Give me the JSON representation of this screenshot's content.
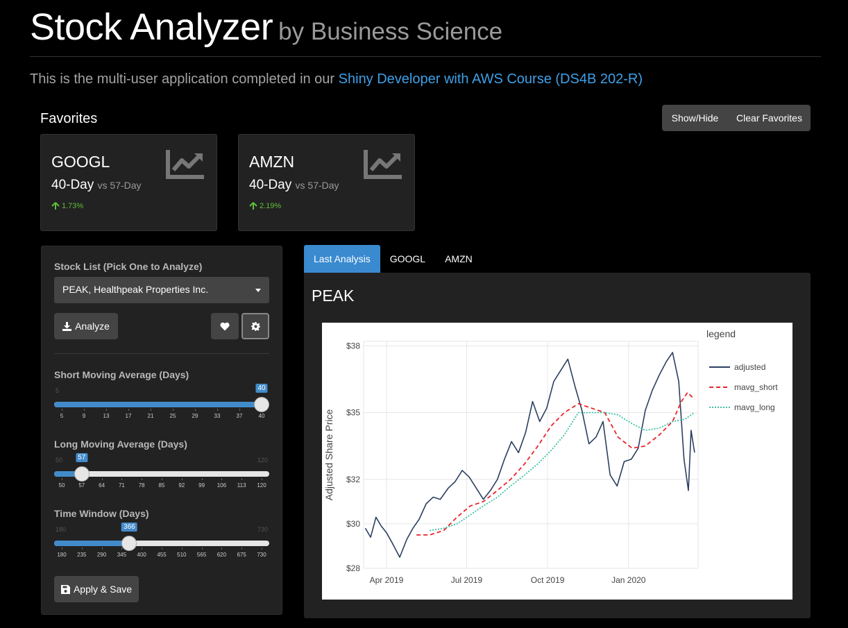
{
  "header": {
    "title": "Stock Analyzer",
    "subtitle": "by Business Science"
  },
  "intro": {
    "text": "This is the multi-user application completed in our ",
    "link": "Shiny Developer with AWS Course (DS4B 202-R)"
  },
  "favorites": {
    "title": "Favorites",
    "show_hide_label": "Show/Hide",
    "clear_label": "Clear Favorites",
    "cards": [
      {
        "symbol": "GOOGL",
        "period": "40-Day",
        "vs": "vs 57-Day",
        "change": "1.73%"
      },
      {
        "symbol": "AMZN",
        "period": "40-Day",
        "vs": "vs 57-Day",
        "change": "2.19%"
      }
    ]
  },
  "sidebar": {
    "stock_list_label": "Stock List (Pick One to Analyze)",
    "selected_stock": "PEAK, Healthpeak Properties Inc.",
    "analyze_label": "Analyze",
    "apply_label": "Apply & Save",
    "sliders": [
      {
        "label": "Short Moving Average (Days)",
        "min": 5,
        "max": 40,
        "value": 40,
        "min_label": "5",
        "max_label": "40",
        "ticks": [
          "5",
          "9",
          "13",
          "17",
          "21",
          "25",
          "29",
          "33",
          "37",
          "40"
        ]
      },
      {
        "label": "Long Moving Average (Days)",
        "min": 50,
        "max": 120,
        "value": 57,
        "min_label": "50",
        "max_label": "120",
        "ticks": [
          "50",
          "57",
          "64",
          "71",
          "78",
          "85",
          "92",
          "99",
          "106",
          "113",
          "120"
        ]
      },
      {
        "label": "Time Window (Days)",
        "min": 180,
        "max": 730,
        "value": 366,
        "min_label": "180",
        "max_label": "730",
        "ticks": [
          "180",
          "235",
          "290",
          "345",
          "400",
          "455",
          "510",
          "565",
          "620",
          "675",
          "730"
        ]
      }
    ]
  },
  "tabs": [
    {
      "label": "Last Analysis",
      "active": true
    },
    {
      "label": "GOOGL",
      "active": false
    },
    {
      "label": "AMZN",
      "active": false
    }
  ],
  "panel": {
    "title": "PEAK"
  },
  "colors": {
    "accent": "#428bca",
    "tab_active": "#3a8ad0",
    "positive": "#5fbf3b",
    "link": "#3fa0e8",
    "adjusted": "#2a3f5f",
    "mavg_short": "#e8252a",
    "mavg_long": "#3cc0a5"
  },
  "chart_data": {
    "type": "line",
    "ylabel": "Adjusted Share Price",
    "legend_title": "legend",
    "legend_position": "right",
    "grid": true,
    "ylim": [
      28,
      38.2
    ],
    "y_ticks": [
      28,
      30,
      32,
      35,
      38
    ],
    "y_tick_labels": [
      "$28",
      "$30",
      "$32",
      "$35",
      "$38"
    ],
    "x_range": [
      "2019-03-06",
      "2020-03-20"
    ],
    "x_ticks": [
      "2019-04-01",
      "2019-07-01",
      "2019-10-01",
      "2020-01-01"
    ],
    "x_tick_labels": [
      "Apr 2019",
      "Jul 2019",
      "Oct 2019",
      "Jan 2020"
    ],
    "series": [
      {
        "name": "adjusted",
        "style": "solid",
        "x": [
          "2019-03-08",
          "2019-03-14",
          "2019-03-20",
          "2019-03-26",
          "2019-04-01",
          "2019-04-08",
          "2019-04-16",
          "2019-04-24",
          "2019-05-01",
          "2019-05-08",
          "2019-05-16",
          "2019-05-24",
          "2019-06-01",
          "2019-06-10",
          "2019-06-18",
          "2019-06-26",
          "2019-07-04",
          "2019-07-12",
          "2019-07-20",
          "2019-07-28",
          "2019-08-05",
          "2019-08-13",
          "2019-08-21",
          "2019-08-29",
          "2019-09-06",
          "2019-09-14",
          "2019-09-22",
          "2019-09-30",
          "2019-10-08",
          "2019-10-16",
          "2019-10-24",
          "2019-11-01",
          "2019-11-09",
          "2019-11-17",
          "2019-11-25",
          "2019-12-03",
          "2019-12-11",
          "2019-12-19",
          "2019-12-27",
          "2020-01-04",
          "2020-01-12",
          "2020-01-20",
          "2020-01-28",
          "2020-02-05",
          "2020-02-13",
          "2020-02-20",
          "2020-02-27",
          "2020-03-04",
          "2020-03-09",
          "2020-03-12",
          "2020-03-16"
        ],
        "y": [
          29.8,
          29.4,
          30.3,
          29.9,
          29.6,
          29.1,
          28.5,
          29.3,
          29.8,
          30.2,
          30.9,
          31.2,
          31.1,
          31.6,
          31.9,
          32.4,
          32.1,
          31.6,
          31.1,
          31.5,
          32.0,
          32.9,
          33.7,
          33.2,
          34.1,
          35.5,
          34.6,
          35.2,
          36.4,
          36.9,
          37.4,
          36.2,
          35.1,
          33.6,
          33.9,
          34.6,
          32.2,
          31.7,
          32.8,
          32.9,
          33.4,
          35.1,
          36.0,
          36.7,
          37.3,
          37.7,
          36.4,
          32.9,
          31.5,
          34.2,
          33.2
        ]
      },
      {
        "name": "mavg_short",
        "style": "dashed",
        "x": [
          "2019-05-05",
          "2019-05-20",
          "2019-06-05",
          "2019-06-20",
          "2019-07-05",
          "2019-07-20",
          "2019-08-05",
          "2019-08-20",
          "2019-09-05",
          "2019-09-20",
          "2019-10-05",
          "2019-10-20",
          "2019-11-05",
          "2019-11-20",
          "2019-12-05",
          "2019-12-20",
          "2020-01-05",
          "2020-01-20",
          "2020-02-05",
          "2020-02-20",
          "2020-03-01",
          "2020-03-08",
          "2020-03-16"
        ],
        "y": [
          29.5,
          29.5,
          29.7,
          30.3,
          30.8,
          31.0,
          31.5,
          32.0,
          32.7,
          33.5,
          34.4,
          35.0,
          35.4,
          35.2,
          35.0,
          33.9,
          33.4,
          33.5,
          34.0,
          34.6,
          35.5,
          35.9,
          35.6
        ]
      },
      {
        "name": "mavg_long",
        "style": "dotted",
        "x": [
          "2019-05-20",
          "2019-06-05",
          "2019-06-20",
          "2019-07-05",
          "2019-07-20",
          "2019-08-05",
          "2019-08-20",
          "2019-09-05",
          "2019-09-20",
          "2019-10-05",
          "2019-10-20",
          "2019-11-05",
          "2019-11-20",
          "2019-12-05",
          "2019-12-20",
          "2020-01-05",
          "2020-01-20",
          "2020-02-05",
          "2020-02-20",
          "2020-03-05",
          "2020-03-16"
        ],
        "y": [
          29.7,
          29.8,
          30.0,
          30.4,
          30.8,
          31.2,
          31.7,
          32.2,
          32.7,
          33.3,
          34.0,
          35.0,
          35.0,
          35.0,
          34.9,
          34.5,
          34.2,
          34.3,
          34.6,
          34.7,
          35.0
        ]
      }
    ]
  }
}
